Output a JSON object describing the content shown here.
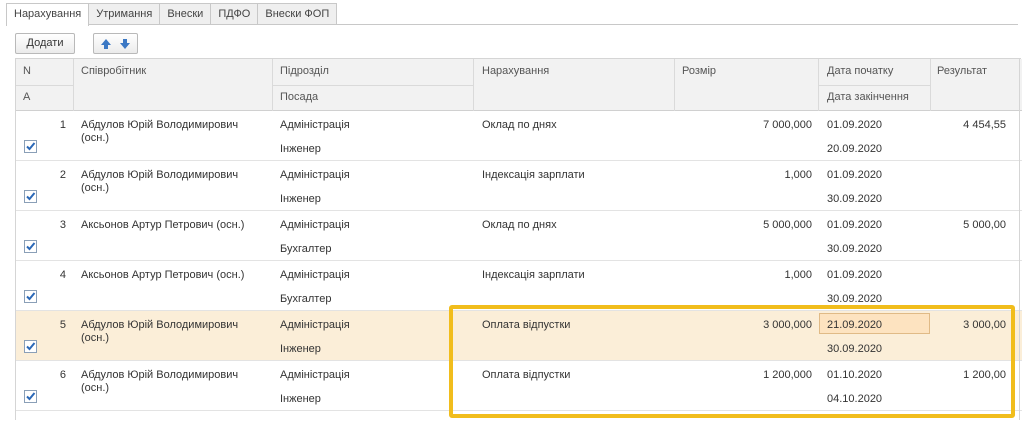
{
  "tabs": [
    "Нарахування",
    "Утримання",
    "Внески",
    "ПДФО",
    "Внески ФОП"
  ],
  "toolbar": {
    "add_label": "Додати"
  },
  "headers": {
    "n": "N",
    "a": "А",
    "employee": "Співробітник",
    "department": "Підрозділ",
    "position": "Посада",
    "accrual": "Нарахування",
    "amount": "Розмір",
    "date_start": "Дата початку",
    "date_end": "Дата закінчення",
    "result": "Результат"
  },
  "rows": [
    {
      "n": "1",
      "employee": "Абдулов Юрій Володимирович",
      "employee2": "(осн.)",
      "department": "Адміністрація",
      "position": "Інженер",
      "accrual": "Оклад по днях",
      "amount": "7 000,000",
      "date_start": "01.09.2020",
      "date_end": "20.09.2020",
      "result": "4 454,55",
      "checked": true,
      "selected": false
    },
    {
      "n": "2",
      "employee": "Абдулов Юрій Володимирович",
      "employee2": "(осн.)",
      "department": "Адміністрація",
      "position": "Інженер",
      "accrual": "Індексація зарплати",
      "amount": "1,000",
      "date_start": "01.09.2020",
      "date_end": "30.09.2020",
      "result": "",
      "checked": true,
      "selected": false
    },
    {
      "n": "3",
      "employee": "Аксьонов Артур Петрович (осн.)",
      "employee2": "",
      "department": "Адміністрація",
      "position": "Бухгалтер",
      "accrual": "Оклад по днях",
      "amount": "5 000,000",
      "date_start": "01.09.2020",
      "date_end": "30.09.2020",
      "result": "5 000,00",
      "checked": true,
      "selected": false
    },
    {
      "n": "4",
      "employee": "Аксьонов Артур Петрович (осн.)",
      "employee2": "",
      "department": "Адміністрація",
      "position": "Бухгалтер",
      "accrual": "Індексація зарплати",
      "amount": "1,000",
      "date_start": "01.09.2020",
      "date_end": "30.09.2020",
      "result": "",
      "checked": true,
      "selected": false
    },
    {
      "n": "5",
      "employee": "Абдулов Юрій Володимирович",
      "employee2": "(осн.)",
      "department": "Адміністрація",
      "position": "Інженер",
      "accrual": "Оплата відпустки",
      "amount": "3 000,000",
      "date_start": "21.09.2020",
      "date_end": "30.09.2020",
      "result": "3 000,00",
      "checked": true,
      "selected": true
    },
    {
      "n": "6",
      "employee": "Абдулов Юрій Володимирович",
      "employee2": "(осн.)",
      "department": "Адміністрація",
      "position": "Інженер",
      "accrual": "Оплата відпустки",
      "amount": "1 200,000",
      "date_start": "01.10.2020",
      "date_end": "04.10.2020",
      "result": "1 200,00",
      "checked": true,
      "selected": false
    }
  ],
  "colors": {
    "highlight": "#f1bd1c",
    "selected_row": "#fbeed8",
    "arrow_blue": "#3b78c4"
  }
}
